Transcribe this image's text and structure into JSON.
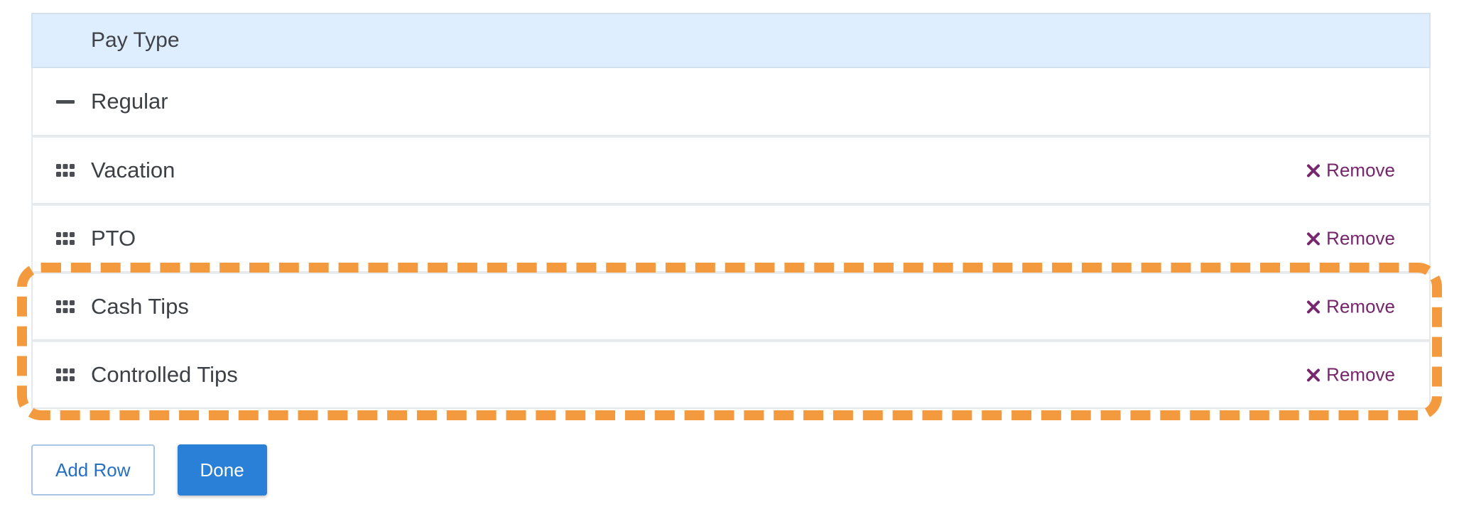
{
  "table": {
    "header": "Pay Type",
    "rows": [
      {
        "label": "Regular",
        "handle_icon": "minus-icon",
        "removable": false
      },
      {
        "label": "Vacation",
        "handle_icon": "drag-handle-icon",
        "removable": true,
        "remove_label": "Remove"
      },
      {
        "label": "PTO",
        "handle_icon": "drag-handle-icon",
        "removable": true,
        "remove_label": "Remove"
      },
      {
        "label": "Cash Tips",
        "handle_icon": "drag-handle-icon",
        "removable": true,
        "remove_label": "Remove"
      },
      {
        "label": "Controlled Tips",
        "handle_icon": "drag-handle-icon",
        "removable": true,
        "remove_label": "Remove"
      }
    ]
  },
  "actions": {
    "add_row_label": "Add Row",
    "done_label": "Done"
  },
  "colors": {
    "header_bg": "#dfeeff",
    "remove": "#76266e",
    "primary": "#2a7fd6",
    "highlight": "#f39a3e"
  }
}
